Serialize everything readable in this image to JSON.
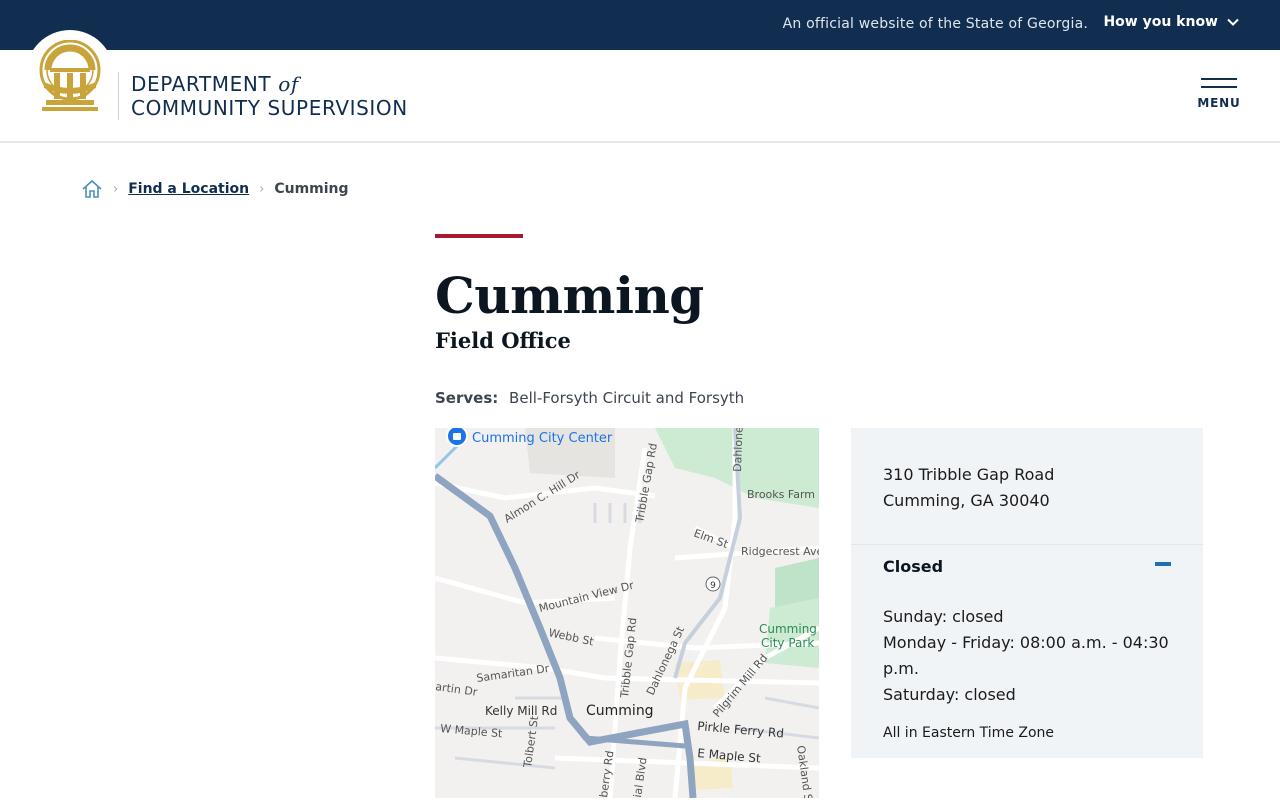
{
  "banner": {
    "official_text": "An official website of the State of Georgia.",
    "how_you_know": "How you know"
  },
  "header": {
    "brand_line1": "DEPARTMENT",
    "brand_of": "of",
    "brand_line2": "COMMUNITY SUPERVISION",
    "menu_label": "MENU"
  },
  "breadcrumb": {
    "link": "Find a Location",
    "current": "Cumming"
  },
  "page": {
    "title": "Cumming",
    "subtitle": "Field Office",
    "serves_label": "Serves:",
    "serves_value": "Bell-Forsyth Circuit and Forsyth"
  },
  "map": {
    "labels": {
      "city_center": "Cumming City Center",
      "almon": "Almon C. Hill Dr",
      "tribble": "Tribble Gap Rd",
      "tribble2": "Tribble Gap Rd",
      "dahlonega_n": "Dahlone",
      "brooks": "Brooks Farm D",
      "elm": "Elm St",
      "ridgecrest": "Ridgecrest Ave",
      "route9": "9",
      "mountain": "Mountain View Dr",
      "webb": "Webb St",
      "dahlonega_s": "Dahlonega St",
      "park": "Cumming City Park",
      "samaritan": "Samaritan Dr",
      "pilgrim": "Pilgrim Mill Rd",
      "martin": "artin Dr",
      "kelly": "Kelly Mill Rd",
      "cumming": "Cumming",
      "pirkle": "Pirkle Ferry Rd",
      "wmaple": "W Maple St",
      "tolbert": "Tolbert St",
      "emaple": "E Maple St",
      "oakland": "Oakland St",
      "berry": "berry Rd",
      "ial": "ial Blvd"
    }
  },
  "location": {
    "address_line1": "310 Tribble Gap Road",
    "address_line2": "Cumming, GA 30040",
    "status": "Closed",
    "hours": [
      "Sunday: closed",
      "Monday - Friday: 08:00 a.m. - 04:30 p.m.",
      "Saturday: closed"
    ],
    "timezone": "All in Eastern Time Zone"
  },
  "colors": {
    "navy": "#112e51",
    "accent_red": "#a6192e",
    "seal_gold": "#c9a43b",
    "panel_bg": "#f1f4f7"
  }
}
